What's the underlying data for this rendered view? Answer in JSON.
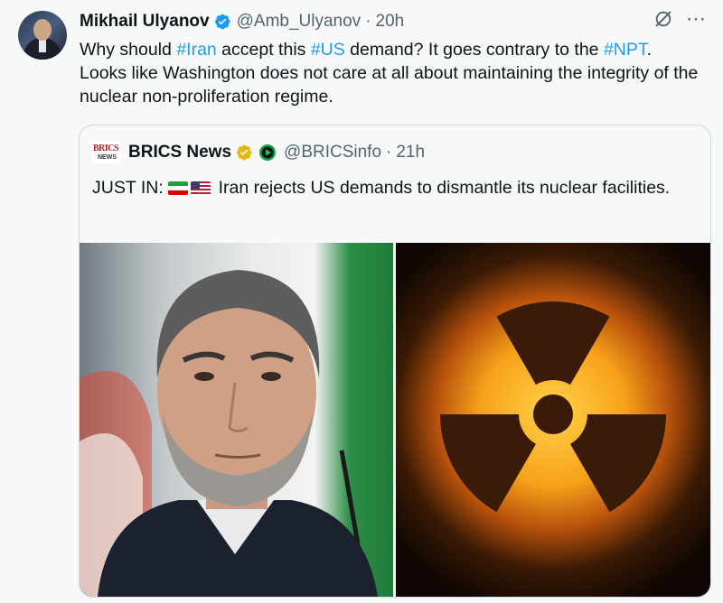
{
  "tweet": {
    "author_name": "Mikhail Ulyanov",
    "handle": "@Amb_Ulyanov",
    "separator": "·",
    "time": "20h",
    "text_parts": {
      "p1": "Why should ",
      "h1": "#Iran",
      "p2": " accept this ",
      "h2": "#US",
      "p3": " demand? It goes contrary to the ",
      "h3": "#NPT",
      "p4": ". Looks like Washington does not care at all about maintaining the integrity of the nuclear non-proliferation regime."
    },
    "more_icon": "⋯",
    "icons": {
      "verified": "verified-badge-icon",
      "grok": "grok-icon",
      "more": "more-icon"
    }
  },
  "quote": {
    "logo_top": "BRICS",
    "logo_bottom": "NEWS",
    "author_name": "BRICS News",
    "handle": "@BRICSinfo",
    "separator": "·",
    "time": "21h",
    "text_prefix": "JUST IN: ",
    "text_body": " Iran rejects US demands to dismantle its nuclear facilities.",
    "flags": [
      "iran-flag-icon",
      "usa-flag-icon"
    ],
    "images": [
      "official-portrait-photo",
      "radiation-symbol-image"
    ]
  },
  "colors": {
    "link": "#1d9bf0",
    "text": "#0f1419",
    "muted": "#536471",
    "verified_blue": "#1d9bf0",
    "verified_gold": "#e2b719",
    "background": "#f7f9f9",
    "border": "#cfd9de"
  }
}
